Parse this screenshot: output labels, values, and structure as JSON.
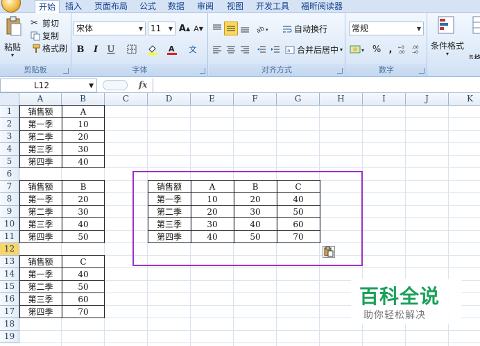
{
  "ribbon": {
    "tabs": [
      "开始",
      "插入",
      "页面布局",
      "公式",
      "数据",
      "审阅",
      "视图",
      "开发工具",
      "福昕阅读器"
    ],
    "active_tab": "开始",
    "clipboard": {
      "paste": "粘贴",
      "cut": "剪切",
      "copy": "复制",
      "format_painter": "格式刷",
      "group": "剪贴板"
    },
    "font": {
      "name": "宋体",
      "size": "11",
      "bold": "B",
      "italic": "I",
      "underline": "U",
      "group": "字体"
    },
    "alignment": {
      "wrap_text": "自动换行",
      "merge_center": "合并后居中",
      "group": "对齐方式"
    },
    "number": {
      "format": "常规",
      "percent": "%",
      "comma": ",",
      "group": "数字"
    },
    "styles": {
      "conditional_format": "条件格式",
      "table_format_partial": "表格"
    }
  },
  "formula_bar": {
    "name_box": "L12",
    "fx": "fx",
    "content": ""
  },
  "sheet": {
    "columns": [
      "A",
      "B",
      "C",
      "D",
      "E",
      "F",
      "G",
      "H",
      "I",
      "J",
      "K"
    ],
    "rows": [
      "1",
      "2",
      "3",
      "4",
      "5",
      "6",
      "7",
      "8",
      "9",
      "10",
      "11",
      "12",
      "13",
      "14",
      "15",
      "16",
      "17",
      "18",
      "19"
    ],
    "selected_row": "12",
    "table_a": [
      [
        "销售额",
        "A"
      ],
      [
        "第一季",
        "10"
      ],
      [
        "第二季",
        "20"
      ],
      [
        "第三季",
        "30"
      ],
      [
        "第四季",
        "40"
      ]
    ],
    "table_b": [
      [
        "销售额",
        "B"
      ],
      [
        "第一季",
        "20"
      ],
      [
        "第二季",
        "30"
      ],
      [
        "第三季",
        "40"
      ],
      [
        "第四季",
        "50"
      ]
    ],
    "table_c": [
      [
        "销售额",
        "C"
      ],
      [
        "第一季",
        "40"
      ],
      [
        "第二季",
        "50"
      ],
      [
        "第三季",
        "60"
      ],
      [
        "第四季",
        "70"
      ]
    ],
    "merged_table": [
      [
        "销售额",
        "A",
        "B",
        "C"
      ],
      [
        "第一季",
        "10",
        "20",
        "40"
      ],
      [
        "第二季",
        "20",
        "30",
        "50"
      ],
      [
        "第三季",
        "30",
        "40",
        "60"
      ],
      [
        "第四季",
        "40",
        "50",
        "70"
      ]
    ],
    "highlight_color": "#9b30c8"
  },
  "watermark": {
    "title": "百科全说",
    "subtitle": "助你轻松解决"
  }
}
